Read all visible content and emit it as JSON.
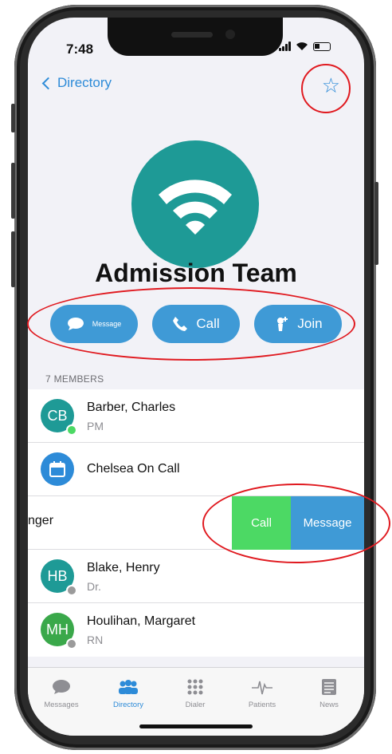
{
  "status_bar": {
    "time": "7:48"
  },
  "nav": {
    "back_label": "Directory",
    "favorite_icon": "star-outline-icon"
  },
  "team": {
    "name": "Admission Team",
    "avatar_icon": "wifi-icon",
    "avatar_color": "#1e9a96"
  },
  "actions": [
    {
      "label": "Message",
      "icon": "chat-bubble-icon"
    },
    {
      "label": "Call",
      "icon": "phone-icon"
    },
    {
      "label": "Join",
      "icon": "person-add-icon"
    }
  ],
  "members_header": "7 MEMBERS",
  "members": [
    {
      "initials": "CB",
      "name": "Barber, Charles",
      "role": "PM",
      "color": "#1e9a96",
      "status": "online"
    },
    {
      "name": "Chelsea On Call",
      "icon": "calendar-icon",
      "color": "#2d8bd8"
    },
    {
      "name_partial": "nger",
      "swipe_call": "Call",
      "swipe_message": "Message"
    },
    {
      "initials": "HB",
      "name": "Blake, Henry",
      "role": "Dr.",
      "color": "#1e9a96",
      "status": "offline"
    },
    {
      "initials": "MH",
      "name": "Houlihan, Margaret",
      "role": "RN",
      "color": "#3aa84a",
      "status": "offline"
    }
  ],
  "tabs": [
    {
      "label": "Messages",
      "icon": "chat-bubble-icon"
    },
    {
      "label": "Directory",
      "icon": "people-icon",
      "active": true
    },
    {
      "label": "Dialer",
      "icon": "keypad-icon"
    },
    {
      "label": "Patients",
      "icon": "pulse-icon"
    },
    {
      "label": "News",
      "icon": "news-icon"
    }
  ],
  "colors": {
    "accent": "#2d8bd8",
    "button": "#3f9ad6",
    "call_green": "#4cd964",
    "annotation_red": "#e0191f"
  }
}
